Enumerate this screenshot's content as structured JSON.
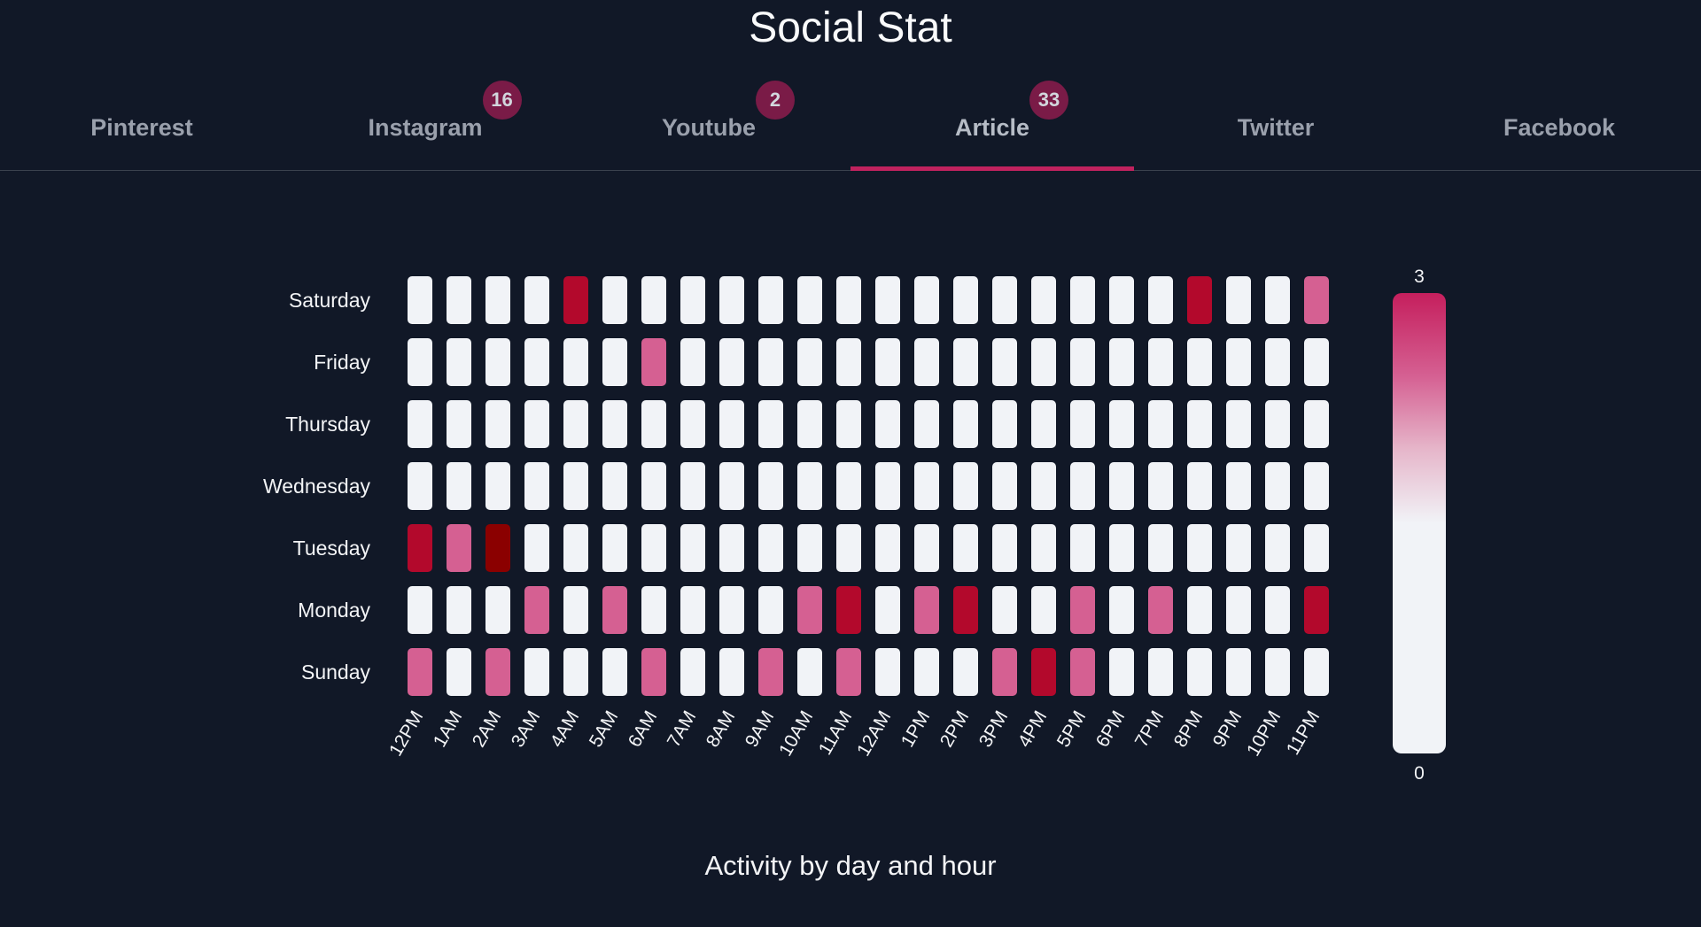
{
  "page_title": "Social Stat",
  "tabs": [
    {
      "label": "Pinterest",
      "badge": null,
      "active": false
    },
    {
      "label": "Instagram",
      "badge": "16",
      "active": false
    },
    {
      "label": "Youtube",
      "badge": "2",
      "active": false
    },
    {
      "label": "Article",
      "badge": "33",
      "active": true
    },
    {
      "label": "Twitter",
      "badge": null,
      "active": false
    },
    {
      "label": "Facebook",
      "badge": null,
      "active": false
    }
  ],
  "colors": {
    "background": "#111827",
    "accent": "#c0225e",
    "scale_low": "#f1f3f7",
    "scale_mid": "#d56092",
    "scale_high": "#b3092c",
    "scale_max": "#8b0000"
  },
  "chart_data": {
    "type": "heatmap",
    "title": "Activity by day and hour",
    "rows": [
      "Saturday",
      "Friday",
      "Thursday",
      "Wednesday",
      "Tuesday",
      "Monday",
      "Sunday"
    ],
    "columns": [
      "12PM",
      "1AM",
      "2AM",
      "3AM",
      "4AM",
      "5AM",
      "6AM",
      "7AM",
      "8AM",
      "9AM",
      "10AM",
      "11AM",
      "12AM",
      "1PM",
      "2PM",
      "3PM",
      "4PM",
      "5PM",
      "6PM",
      "7PM",
      "8PM",
      "9PM",
      "10PM",
      "11PM"
    ],
    "values": [
      [
        0,
        0,
        0,
        0,
        2,
        0,
        0,
        0,
        0,
        0,
        0,
        0,
        0,
        0,
        0,
        0,
        0,
        0,
        0,
        0,
        2,
        0,
        0,
        1
      ],
      [
        0,
        0,
        0,
        0,
        0,
        0,
        1,
        0,
        0,
        0,
        0,
        0,
        0,
        0,
        0,
        0,
        0,
        0,
        0,
        0,
        0,
        0,
        0,
        0
      ],
      [
        0,
        0,
        0,
        0,
        0,
        0,
        0,
        0,
        0,
        0,
        0,
        0,
        0,
        0,
        0,
        0,
        0,
        0,
        0,
        0,
        0,
        0,
        0,
        0
      ],
      [
        0,
        0,
        0,
        0,
        0,
        0,
        0,
        0,
        0,
        0,
        0,
        0,
        0,
        0,
        0,
        0,
        0,
        0,
        0,
        0,
        0,
        0,
        0,
        0
      ],
      [
        2,
        1,
        3,
        0,
        0,
        0,
        0,
        0,
        0,
        0,
        0,
        0,
        0,
        0,
        0,
        0,
        0,
        0,
        0,
        0,
        0,
        0,
        0,
        0
      ],
      [
        0,
        0,
        0,
        1,
        0,
        1,
        0,
        0,
        0,
        0,
        1,
        2,
        0,
        1,
        2,
        0,
        0,
        1,
        0,
        1,
        0,
        0,
        0,
        2
      ],
      [
        1,
        0,
        1,
        0,
        0,
        0,
        1,
        0,
        0,
        1,
        0,
        1,
        0,
        0,
        0,
        1,
        2,
        1,
        0,
        0,
        0,
        0,
        0,
        0
      ]
    ],
    "scale": {
      "min": 0,
      "max": 3,
      "min_label": "0",
      "max_label": "3"
    }
  }
}
